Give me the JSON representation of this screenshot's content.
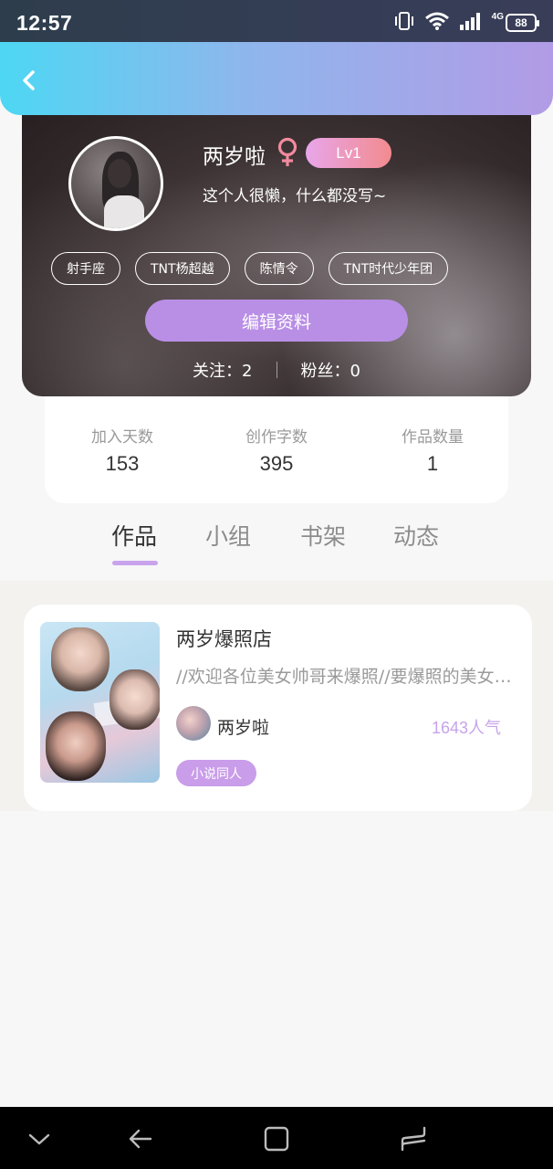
{
  "status_bar": {
    "time": "12:57",
    "network": "4G",
    "battery": "88"
  },
  "profile": {
    "username": "两岁啦",
    "level": "Lv1",
    "bio": "这个人很懒，什么都没写~",
    "tags": [
      "射手座",
      "TNT杨超越",
      "陈情令",
      "TNT时代少年团"
    ],
    "edit_label": "编辑资料",
    "following_label": "关注：",
    "following_count": "2",
    "followers_label": "粉丝：",
    "followers_count": "0"
  },
  "stats": [
    {
      "label": "加入天数",
      "value": "153"
    },
    {
      "label": "创作字数",
      "value": "395"
    },
    {
      "label": "作品数量",
      "value": "1"
    }
  ],
  "tabs": [
    "作品",
    "小组",
    "书架",
    "动态"
  ],
  "work": {
    "title": "两岁爆照店",
    "description": "//欢迎各位美女帅哥来爆照//要爆照的美女帅哥请评论区留言",
    "author": "两岁啦",
    "popularity": "1643人气",
    "category": "小说同人"
  },
  "colors": {
    "accent": "#b98fe6",
    "header_gradient_start": "#4dd7f3",
    "header_gradient_end": "#b29be6",
    "level_badge_start": "#e8a6ea",
    "level_badge_end": "#f28b8e",
    "gender_icon": "#f28b9e"
  }
}
